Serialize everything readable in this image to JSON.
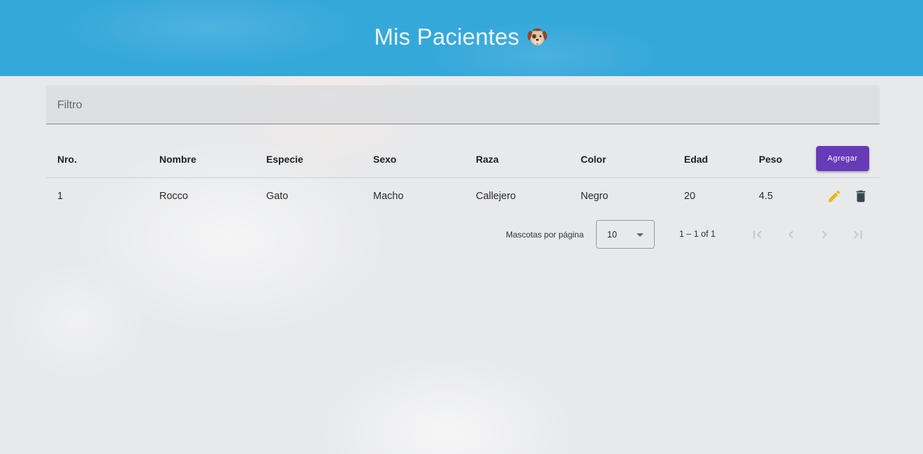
{
  "header": {
    "title": "Mis Pacientes",
    "icon": "dog-face-icon"
  },
  "filter": {
    "placeholder": "Filtro",
    "value": ""
  },
  "table": {
    "columns": [
      "Nro.",
      "Nombre",
      "Especie",
      "Sexo",
      "Raza",
      "Color",
      "Edad",
      "Peso"
    ],
    "add_button_label": "Agregar",
    "rows": [
      {
        "nro": "1",
        "nombre": "Rocco",
        "especie": "Gato",
        "sexo": "Macho",
        "raza": "Callejero",
        "color": "Negro",
        "edad": "20",
        "peso": "4.5"
      }
    ]
  },
  "paginator": {
    "label": "Mascotas por página",
    "page_size": "10",
    "range": "1 – 1 of 1"
  },
  "colors": {
    "header_bg": "#35a8da",
    "primary_button": "#673ab7",
    "edit_icon": "#e8b90c",
    "delete_icon": "#37474f"
  }
}
